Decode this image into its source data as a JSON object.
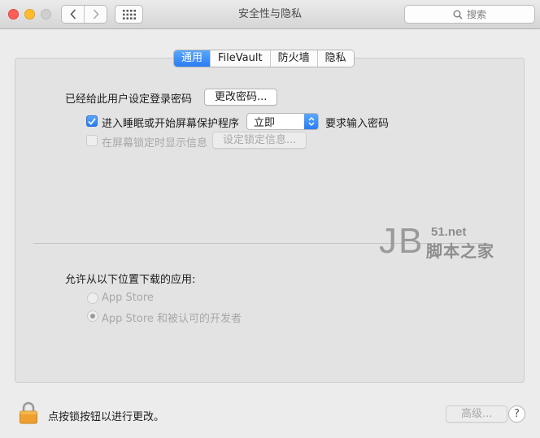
{
  "window": {
    "title": "安全性与隐私"
  },
  "toolbar": {
    "search_placeholder": "搜索"
  },
  "tabs": [
    {
      "label": "通用",
      "active": true
    },
    {
      "label": "FileVault",
      "active": false
    },
    {
      "label": "防火墙",
      "active": false
    },
    {
      "label": "隐私",
      "active": false
    }
  ],
  "general": {
    "password_label": "已经给此用户设定登录密码",
    "change_password_button": "更改密码...",
    "require_password_checkbox": {
      "label": "进入睡眠或开始屏幕保护程序",
      "checked": true
    },
    "require_password_select": {
      "value": "立即"
    },
    "require_password_suffix": "要求输入密码",
    "show_message_checkbox": {
      "label": "在屏幕锁定时显示信息",
      "checked": false,
      "disabled": true
    },
    "set_lock_message_button": "设定锁定信息..."
  },
  "downloads": {
    "label": "允许从以下位置下载的应用:",
    "options": [
      {
        "label": "App Store",
        "selected": false
      },
      {
        "label": "App Store 和被认可的开发者",
        "selected": true
      }
    ]
  },
  "watermark": {
    "brand": "JB",
    "domain": "51.net",
    "name": "脚本之家"
  },
  "footer": {
    "lock_label": "点按锁按钮以进行更改。",
    "advanced_button": "高级...",
    "help_label": "?"
  },
  "colors": {
    "accent": "#2a7cf4",
    "lock": "#f0a030"
  }
}
